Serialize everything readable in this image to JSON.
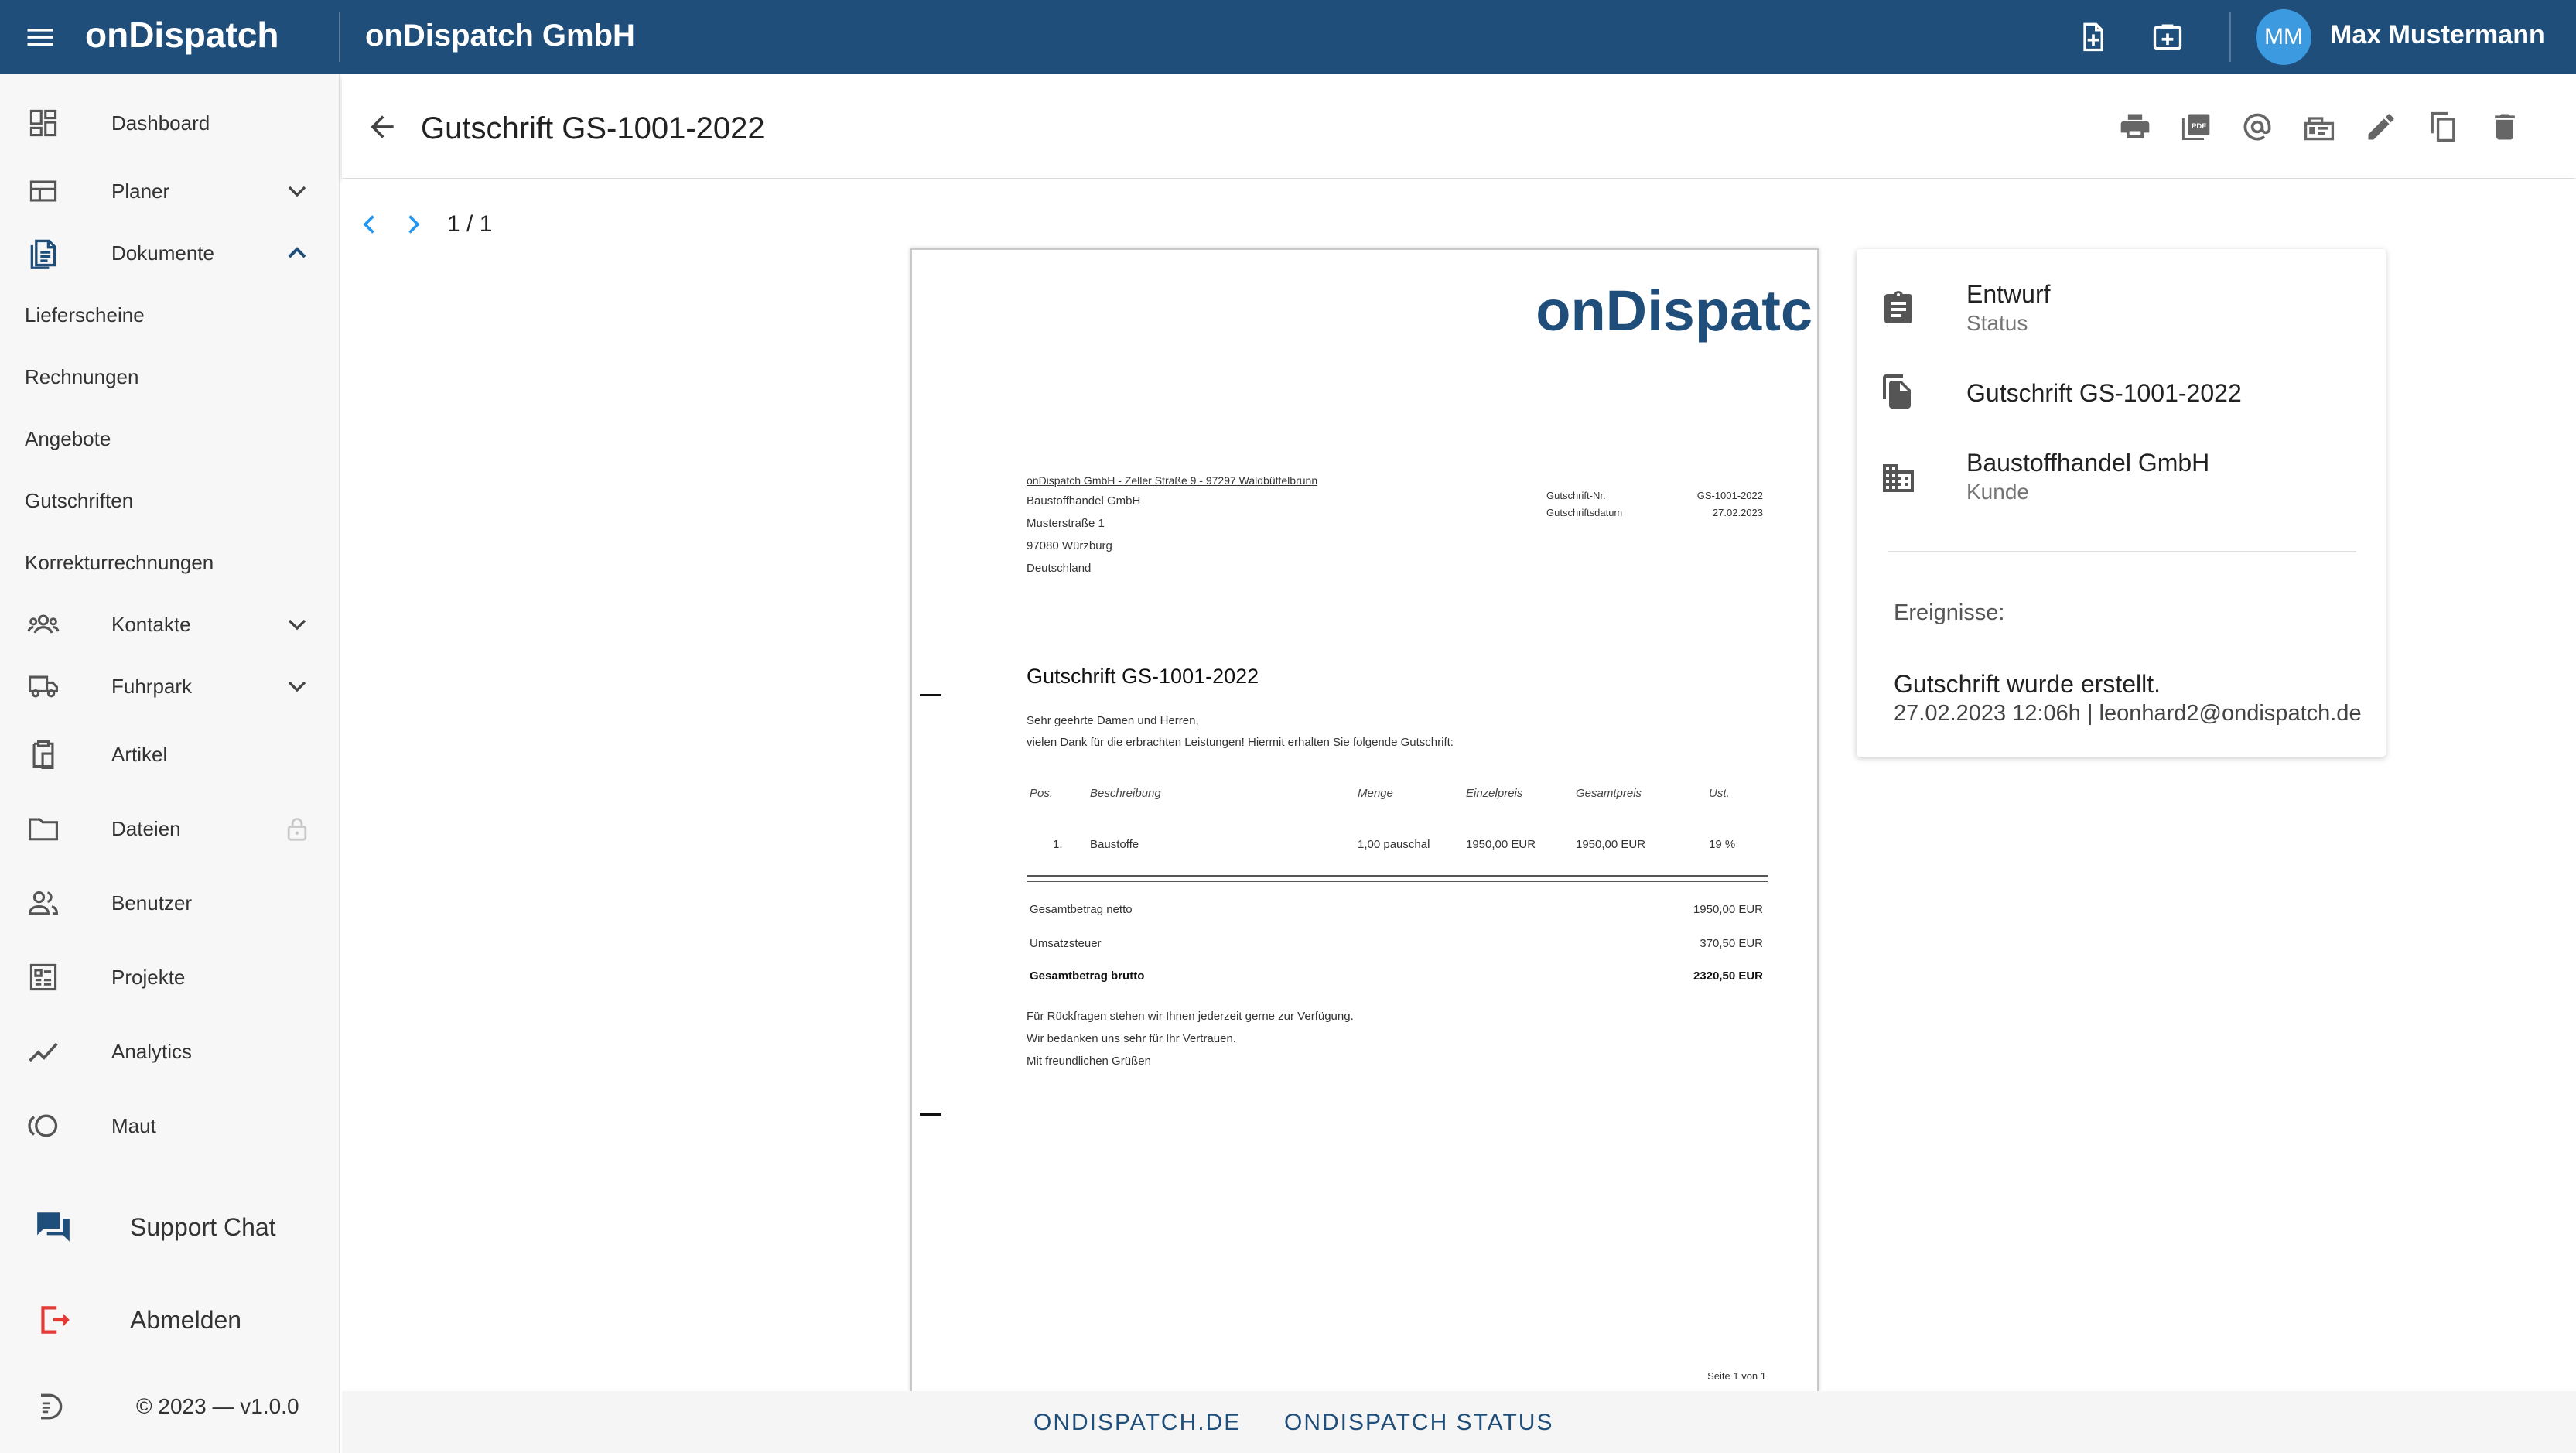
{
  "topbar": {
    "logo": "onDispatch",
    "company": "onDispatch GmbH",
    "user_initials": "MM",
    "user_name": "Max Mustermann",
    "icons": [
      "menu-icon",
      "note-add-icon",
      "add-box-icon"
    ]
  },
  "sidebar": {
    "items": [
      {
        "label": "Dashboard",
        "icon": "dashboard-icon"
      },
      {
        "label": "Planer",
        "icon": "planner-icon"
      },
      {
        "label": "Dokumente",
        "icon": "documents-icon"
      },
      {
        "label": "Kontakte",
        "icon": "contacts-icon"
      },
      {
        "label": "Fuhrpark",
        "icon": "truck-icon"
      },
      {
        "label": "Artikel",
        "icon": "article-icon"
      },
      {
        "label": "Dateien",
        "icon": "folder-icon"
      },
      {
        "label": "Benutzer",
        "icon": "users-icon"
      },
      {
        "label": "Projekte",
        "icon": "projects-icon"
      },
      {
        "label": "Analytics",
        "icon": "analytics-icon"
      },
      {
        "label": "Maut",
        "icon": "toll-icon"
      }
    ],
    "sub_items": [
      "Lieferscheine",
      "Rechnungen",
      "Angebote",
      "Gutschriften",
      "Korrekturrechnungen"
    ],
    "support_label": "Support Chat",
    "logout_label": "Abmelden",
    "copyright": "© 2023 — v1.0.0"
  },
  "header": {
    "title": "Gutschrift GS-1001-2022",
    "actions": [
      "print-icon",
      "pdf-icon",
      "email-icon",
      "send-icon",
      "edit-icon",
      "copy-icon",
      "delete-icon"
    ]
  },
  "pager": {
    "page": "1 / 1"
  },
  "document": {
    "logo": "onDispatc",
    "sender_line": "onDispatch GmbH - Zeller Straße 9 - 97297 Waldbüttelbrunn",
    "recipient": [
      "Baustoffhandel GmbH",
      "Musterstraße 1",
      "97080 Würzburg",
      "Deutschland"
    ],
    "meta": [
      {
        "label": "Gutschrift-Nr.",
        "value": "GS-1001-2022"
      },
      {
        "label": "Gutschriftsdatum",
        "value": "27.02.2023"
      }
    ],
    "title": "Gutschrift GS-1001-2022",
    "greeting": "Sehr geehrte Damen und Herren,",
    "intro": "vielen Dank für die erbrachten Leistungen! Hiermit erhalten Sie folgende Gutschrift:",
    "table_headers": [
      "Pos.",
      "Beschreibung",
      "Menge",
      "Einzelpreis",
      "Gesamtpreis",
      "Ust."
    ],
    "row": {
      "pos": "1.",
      "desc": "Baustoffe",
      "qty": "1,00 pauschal",
      "unit": "1950,00 EUR",
      "total": "1950,00 EUR",
      "vat": "19 %"
    },
    "totals": [
      {
        "label": "Gesamtbetrag netto",
        "value": "1950,00 EUR"
      },
      {
        "label": "Umsatzsteuer",
        "value": "370,50 EUR"
      },
      {
        "label": "Gesamtbetrag brutto",
        "value": "2320,50 EUR"
      }
    ],
    "closing": [
      "Für Rückfragen stehen wir Ihnen jederzeit gerne zur Verfügung.",
      "Wir bedanken uns sehr für Ihr Vertrauen.",
      "Mit freundlichen Grüßen"
    ],
    "page_footer": "Seite 1 von 1"
  },
  "info": {
    "status_value": "Entwurf",
    "status_label": "Status",
    "doc_name": "Gutschrift GS-1001-2022",
    "customer_value": "Baustoffhandel GmbH",
    "customer_label": "Kunde",
    "events_label": "Ereignisse:",
    "event_text": "Gutschrift wurde erstellt.",
    "event_meta": "27.02.2023 12:06h | leonhard2@ondispatch.de"
  },
  "footer": {
    "link1": "ONDISPATCH.DE",
    "link2": "ONDISPATCH STATUS"
  },
  "colors": {
    "primary": "#1f4e7a",
    "avatar": "#3c9be0",
    "logout": "#e53935",
    "pager": "#2196f3"
  }
}
